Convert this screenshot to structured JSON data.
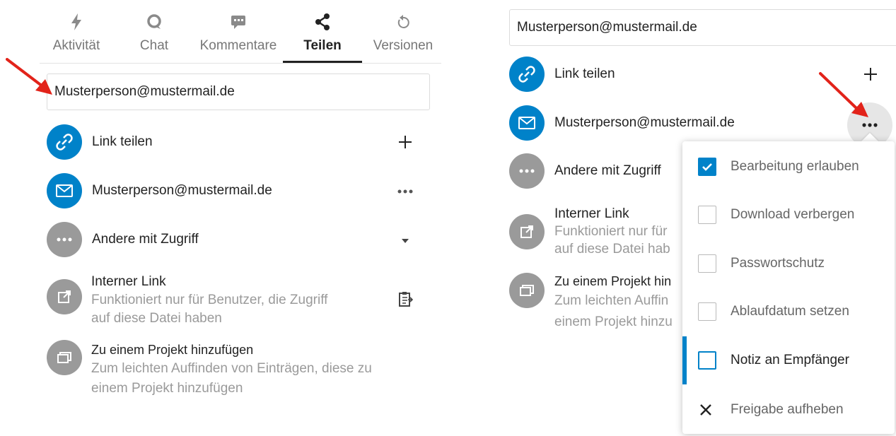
{
  "tabs": [
    {
      "label": "Aktivität",
      "icon": "lightning-icon"
    },
    {
      "label": "Chat",
      "icon": "chat-bubble-icon"
    },
    {
      "label": "Kommentare",
      "icon": "comment-icon"
    },
    {
      "label": "Teilen",
      "icon": "share-icon",
      "active": true
    },
    {
      "label": "Versionen",
      "icon": "history-icon"
    }
  ],
  "left": {
    "share_input_value": "Musterperson@mustermail.de",
    "link_share_label": "Link teilen",
    "email_share_label": "Musterperson@mustermail.de",
    "others_label": "Andere mit Zugriff",
    "internal_link_title": "Interner Link",
    "internal_link_sub_1": "Funktioniert nur für Benutzer, die Zugriff",
    "internal_link_sub_2": "auf diese Datei haben",
    "project_title": "Zu einem Projekt hinzufügen",
    "project_sub_1": "Zum leichten Auffinden von Einträgen, diese zu",
    "project_sub_2": "einem Projekt hinzufügen"
  },
  "right": {
    "share_input_value": "Musterperson@mustermail.de",
    "link_share_label": "Link teilen",
    "email_share_label": "Musterperson@mustermail.de",
    "others_label": "Andere mit Zugriff",
    "internal_link_title": "Interner Link",
    "internal_link_sub_1": "Funktioniert nur für",
    "internal_link_sub_2": "auf diese Datei hab",
    "project_title": "Zu einem Projekt hin",
    "project_sub_1": "Zum leichten Auffin",
    "project_sub_2": "einem Projekt hinzu"
  },
  "menu": {
    "items": [
      {
        "label": "Bearbeitung erlauben",
        "checked": true
      },
      {
        "label": "Download verbergen",
        "checked": false
      },
      {
        "label": "Passwortschutz",
        "checked": false
      },
      {
        "label": "Ablaufdatum setzen",
        "checked": false
      },
      {
        "label": "Notiz an Empfänger",
        "checked": false,
        "focused": true
      },
      {
        "label": "Freigabe aufheben",
        "icon": "close-icon"
      }
    ]
  },
  "colors": {
    "accent": "#0082c9",
    "avatar_grey": "#9a9a9a",
    "annotation_arrow": "#e2231a"
  }
}
